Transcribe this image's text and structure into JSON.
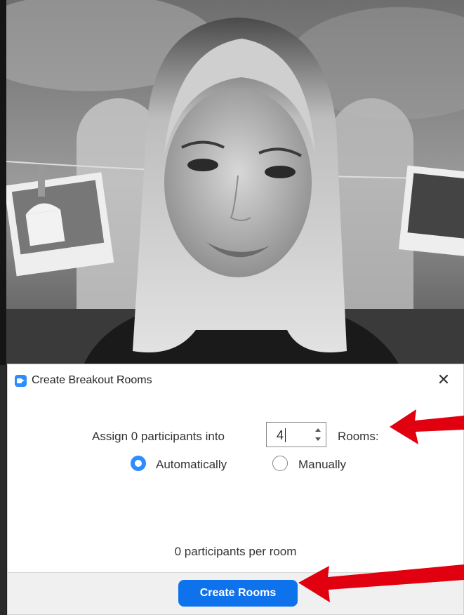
{
  "dialog": {
    "title": "Create Breakout Rooms",
    "close_glyph": "✕",
    "assign_label": "Assign 0 participants into",
    "rooms_value": "4",
    "rooms_label": "Rooms:",
    "options": [
      {
        "label": "Automatically",
        "selected": true
      },
      {
        "label": "Manually",
        "selected": false
      }
    ],
    "per_room_text": "0 participants per room",
    "create_button": "Create Rooms"
  },
  "colors": {
    "accent": "#2d8cff",
    "button": "#0e72ed",
    "arrow": "#e0000f"
  },
  "icons": {
    "app": "zoom-camera-icon",
    "close": "close-icon",
    "spin_up": "chevron-up-icon",
    "spin_down": "chevron-down-icon"
  }
}
